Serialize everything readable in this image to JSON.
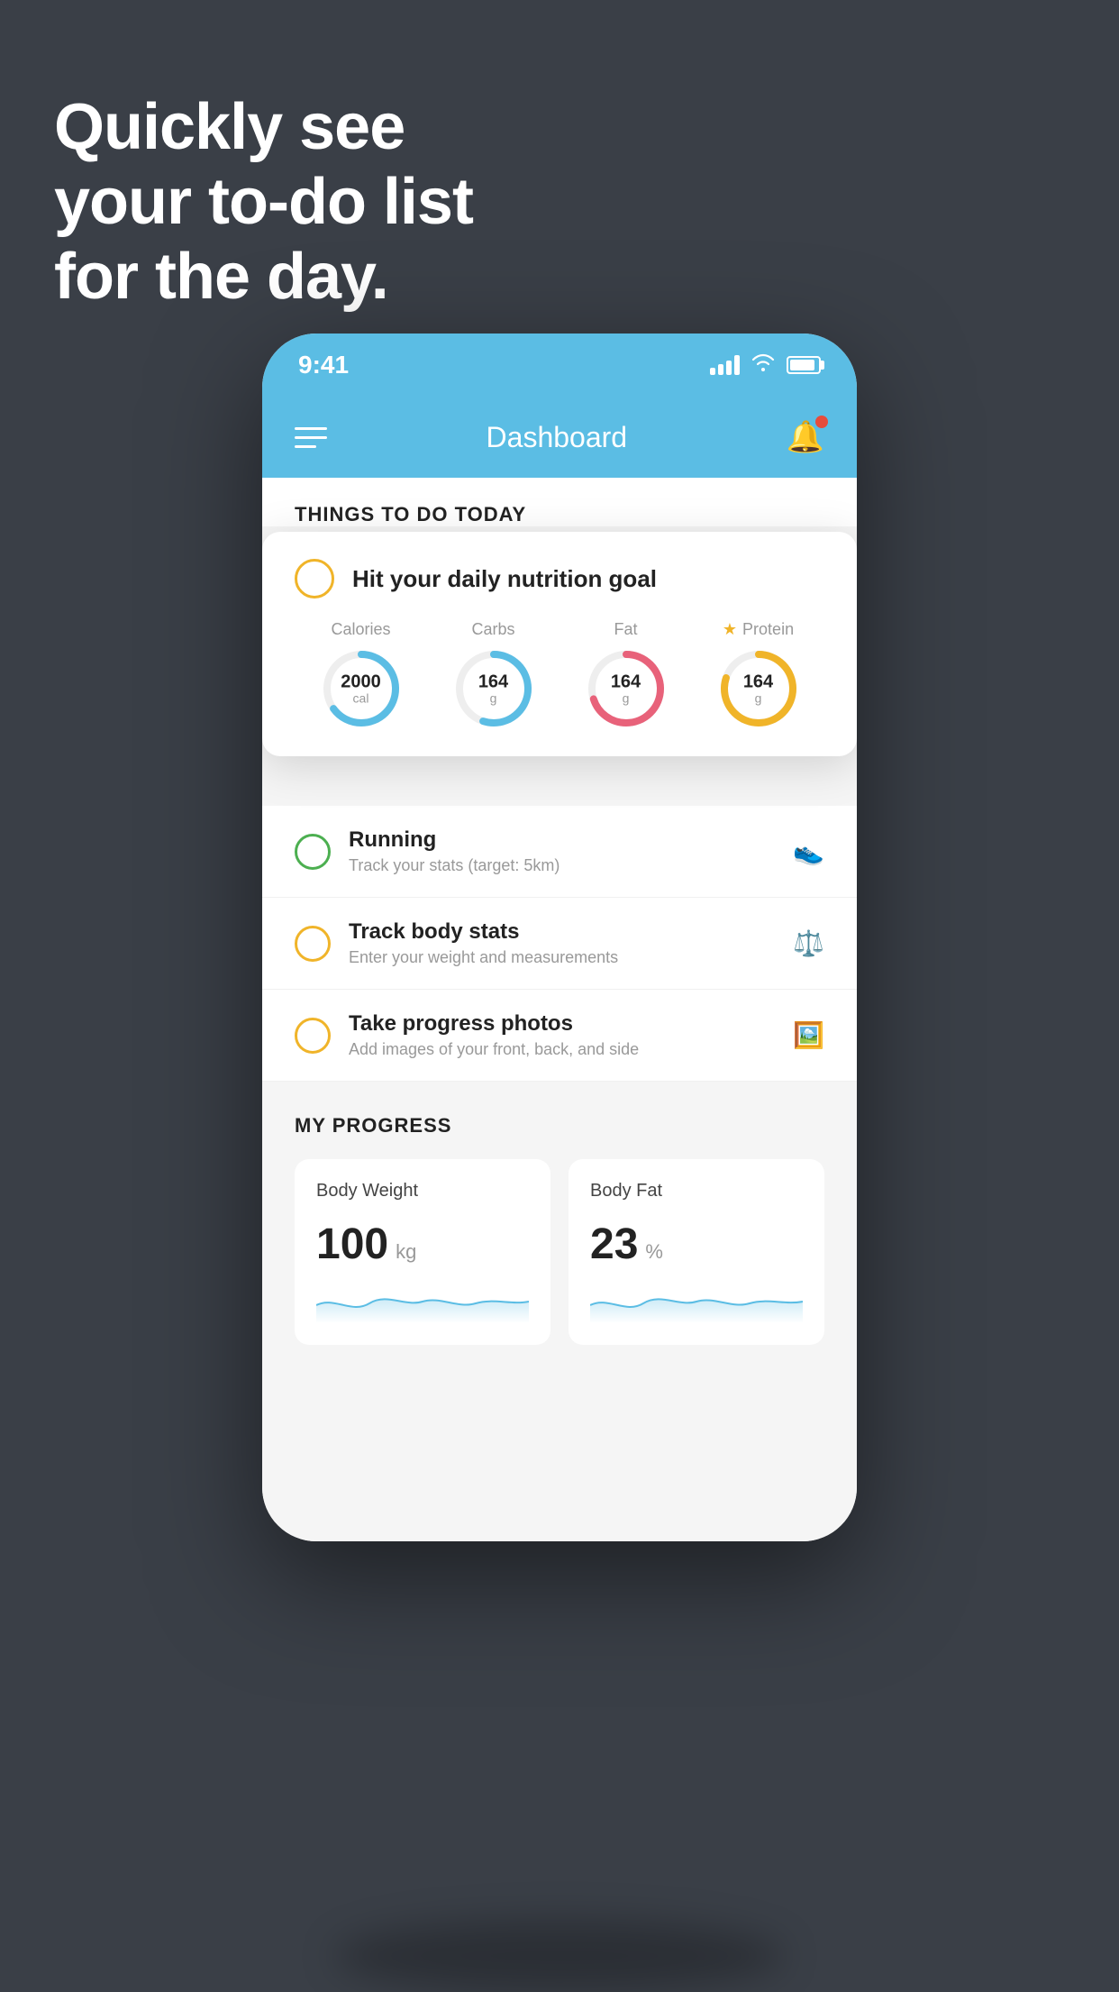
{
  "background": "#3a3f47",
  "headline": {
    "line1": "Quickly see",
    "line2": "your to-do list",
    "line3": "for the day."
  },
  "statusBar": {
    "time": "9:41"
  },
  "header": {
    "title": "Dashboard"
  },
  "thingsSection": {
    "title": "THINGS TO DO TODAY"
  },
  "nutritionCard": {
    "title": "Hit your daily nutrition goal",
    "macros": [
      {
        "label": "Calories",
        "value": "2000",
        "unit": "cal",
        "color": "#5bbde4",
        "percent": 65
      },
      {
        "label": "Carbs",
        "value": "164",
        "unit": "g",
        "color": "#5bbde4",
        "percent": 55
      },
      {
        "label": "Fat",
        "value": "164",
        "unit": "g",
        "color": "#e8627a",
        "percent": 70
      },
      {
        "label": "Protein",
        "value": "164",
        "unit": "g",
        "color": "#f0b429",
        "percent": 80,
        "starred": true
      }
    ]
  },
  "todoItems": [
    {
      "name": "Running",
      "desc": "Track your stats (target: 5km)",
      "circleColor": "green",
      "iconType": "shoe"
    },
    {
      "name": "Track body stats",
      "desc": "Enter your weight and measurements",
      "circleColor": "yellow",
      "iconType": "scale"
    },
    {
      "name": "Take progress photos",
      "desc": "Add images of your front, back, and side",
      "circleColor": "yellow",
      "iconType": "photo"
    }
  ],
  "progressSection": {
    "title": "MY PROGRESS",
    "cards": [
      {
        "title": "Body Weight",
        "value": "100",
        "unit": "kg"
      },
      {
        "title": "Body Fat",
        "value": "23",
        "unit": "%"
      }
    ]
  }
}
